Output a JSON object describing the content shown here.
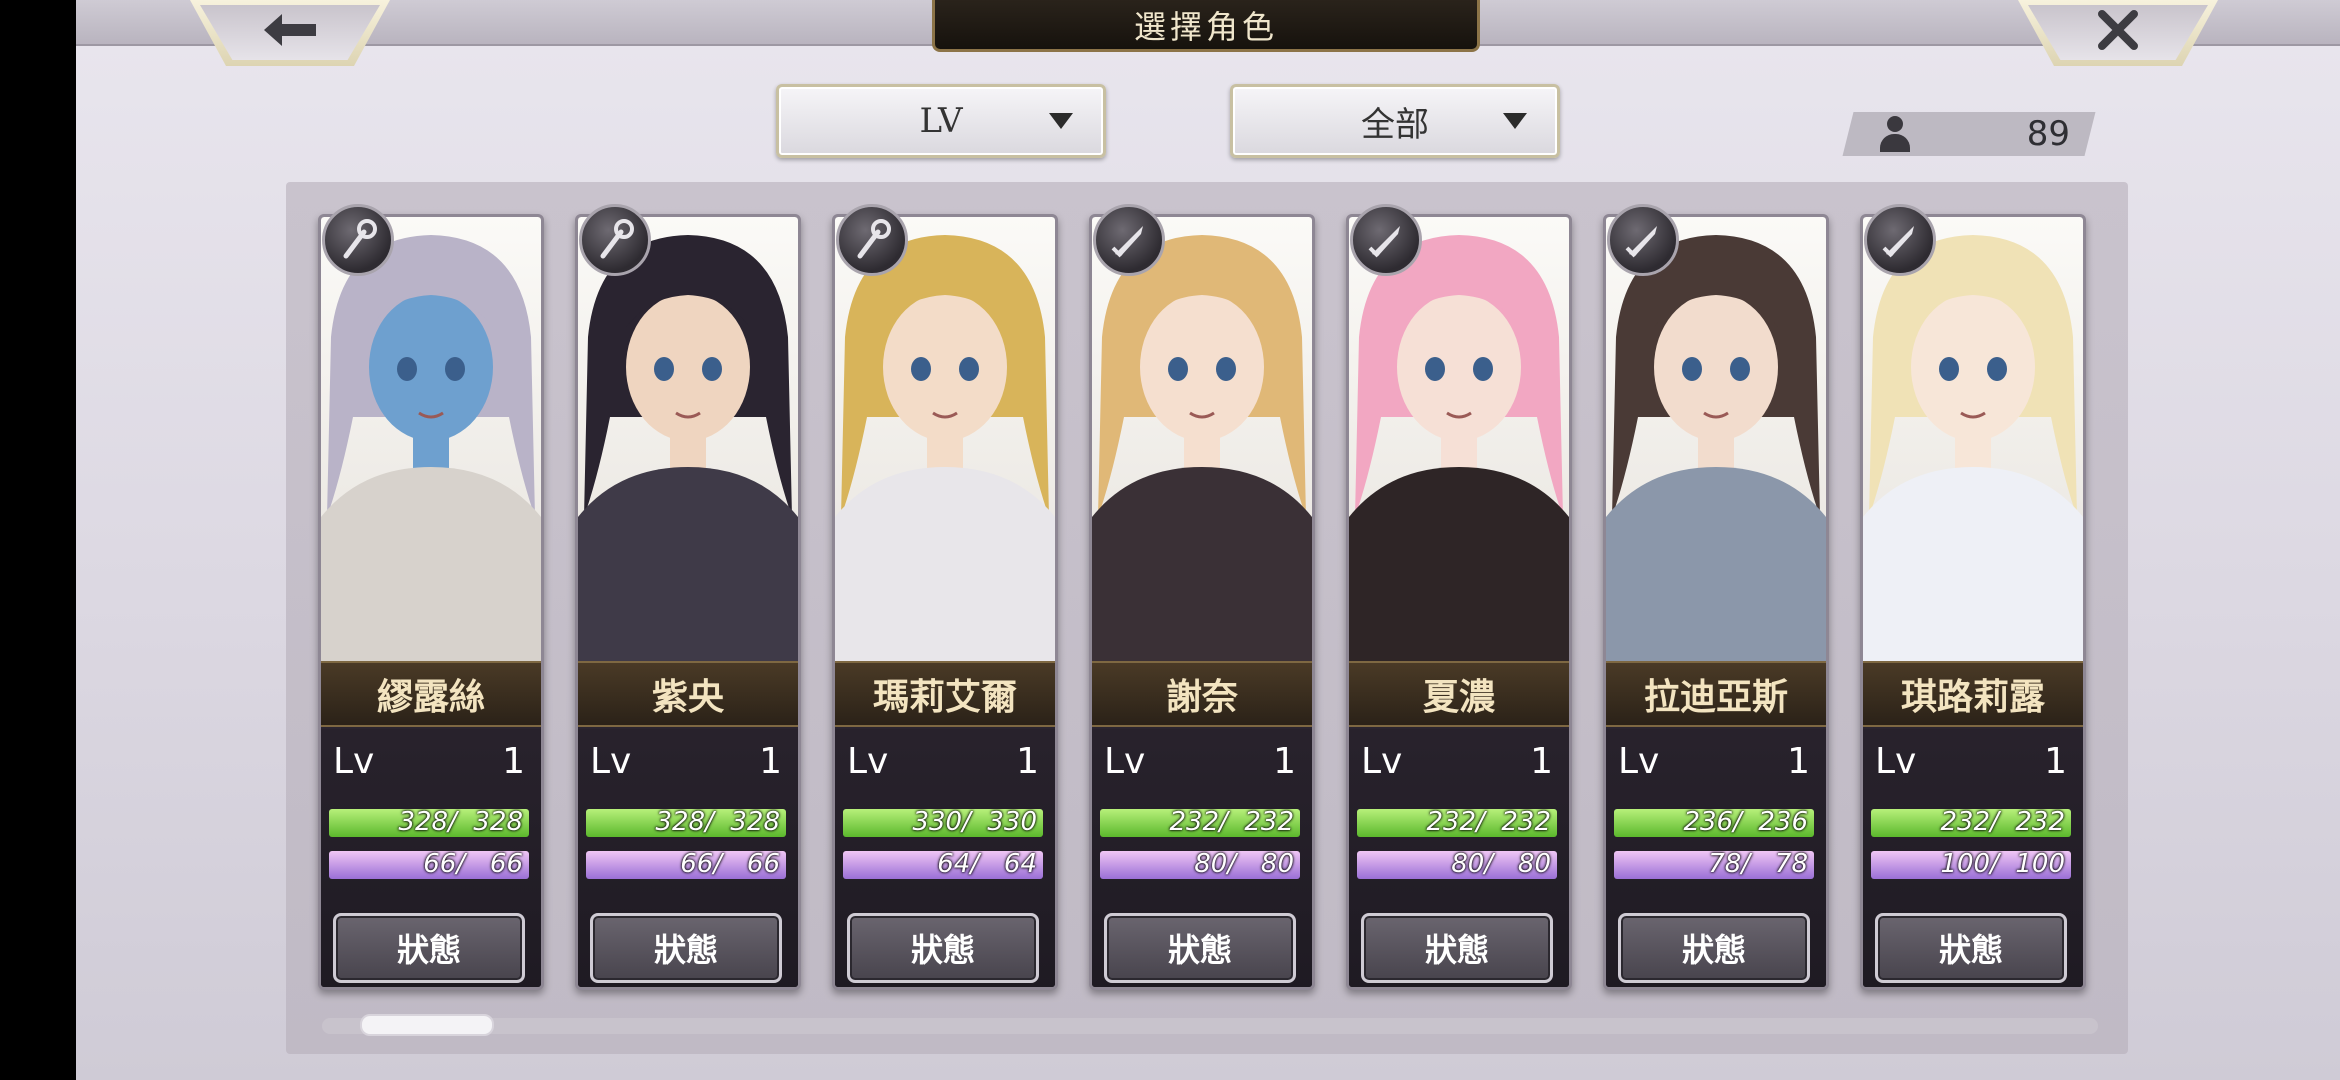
{
  "header": {
    "title": "選擇角色",
    "back_icon": "arrow-left-icon",
    "close_icon": "close-icon"
  },
  "filters": {
    "sort": {
      "value": "LV",
      "icon": "chevron-down-icon"
    },
    "category": {
      "value": "全部",
      "icon": "chevron-down-icon"
    }
  },
  "character_count": {
    "icon": "person-icon",
    "value": "89"
  },
  "status_button_label": "狀態",
  "characters": [
    {
      "name": "繆露絲",
      "weapon": "staff-icon",
      "lv_label": "Lv",
      "lv": "1",
      "hp_text": "328/  328",
      "hp_fraction": 1.0,
      "mp_text": "66/   66",
      "mp_fraction": 1.0,
      "hair": "#b9b3c8",
      "skin": "#6ea0cf",
      "outfit": "#d7d2cc"
    },
    {
      "name": "紫央",
      "weapon": "staff-icon",
      "lv_label": "Lv",
      "lv": "1",
      "hp_text": "328/  328",
      "hp_fraction": 1.0,
      "mp_text": "66/   66",
      "mp_fraction": 1.0,
      "hair": "#2a2430",
      "skin": "#efd5c0",
      "outfit": "#3f3a48"
    },
    {
      "name": "瑪莉艾爾",
      "weapon": "staff-icon",
      "lv_label": "Lv",
      "lv": "1",
      "hp_text": "330/  330",
      "hp_fraction": 1.0,
      "mp_text": "64/   64",
      "mp_fraction": 1.0,
      "hair": "#d8b45a",
      "skin": "#f3dcc8",
      "outfit": "#e8e6ea"
    },
    {
      "name": "謝奈",
      "weapon": "sword-icon",
      "lv_label": "Lv",
      "lv": "1",
      "hp_text": "232/  232",
      "hp_fraction": 1.0,
      "mp_text": "80/   80",
      "mp_fraction": 1.0,
      "hair": "#e0b877",
      "skin": "#f5dfcf",
      "outfit": "#3a3036"
    },
    {
      "name": "夏濃",
      "weapon": "sword-icon",
      "lv_label": "Lv",
      "lv": "1",
      "hp_text": "232/  232",
      "hp_fraction": 1.0,
      "mp_text": "80/   80",
      "mp_fraction": 1.0,
      "hair": "#f2a7c2",
      "skin": "#f6e0d6",
      "outfit": "#2e2526"
    },
    {
      "name": "拉迪亞斯",
      "weapon": "sword-icon",
      "lv_label": "Lv",
      "lv": "1",
      "hp_text": "236/  236",
      "hp_fraction": 1.0,
      "mp_text": "78/   78",
      "mp_fraction": 1.0,
      "hair": "#4a3a36",
      "skin": "#f2dccd",
      "outfit": "#8b97aa"
    },
    {
      "name": "琪路莉露",
      "weapon": "sword-icon",
      "lv_label": "Lv",
      "lv": "1",
      "hp_text": "232/  232",
      "hp_fraction": 1.0,
      "mp_text": "100/  100",
      "mp_fraction": 1.0,
      "hair": "#f0e2b6",
      "skin": "#f7e6d8",
      "outfit": "#eef0f6"
    }
  ]
}
